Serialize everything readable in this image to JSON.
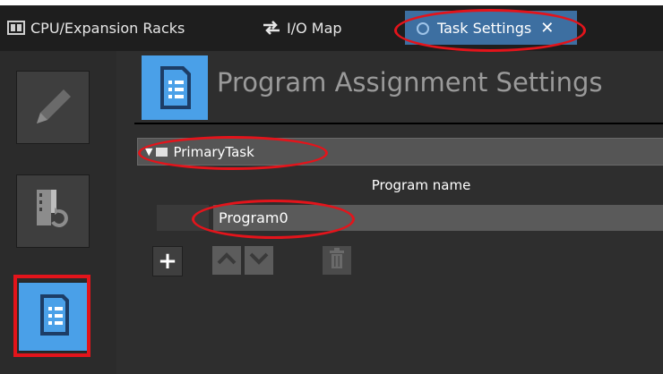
{
  "tabs": [
    {
      "label": "CPU/Expansion Racks",
      "icon": "rack-icon"
    },
    {
      "label": "I/O Map",
      "icon": "swap-arrows-icon"
    },
    {
      "label": "Task Settings",
      "icon": "task-icon",
      "active": true,
      "close_glyph": "✕"
    }
  ],
  "main": {
    "title": "Program Assignment Settings",
    "task": {
      "name": "PrimaryTask",
      "expand_glyph": "▼"
    },
    "column_header": "Program name",
    "rows": [
      {
        "program": "Program0"
      }
    ],
    "actions": {
      "add_glyph": "+"
    }
  },
  "colors": {
    "accent_blue": "#4aa0e8",
    "highlight_red": "#e3141b",
    "background": "#2e2e2e"
  }
}
